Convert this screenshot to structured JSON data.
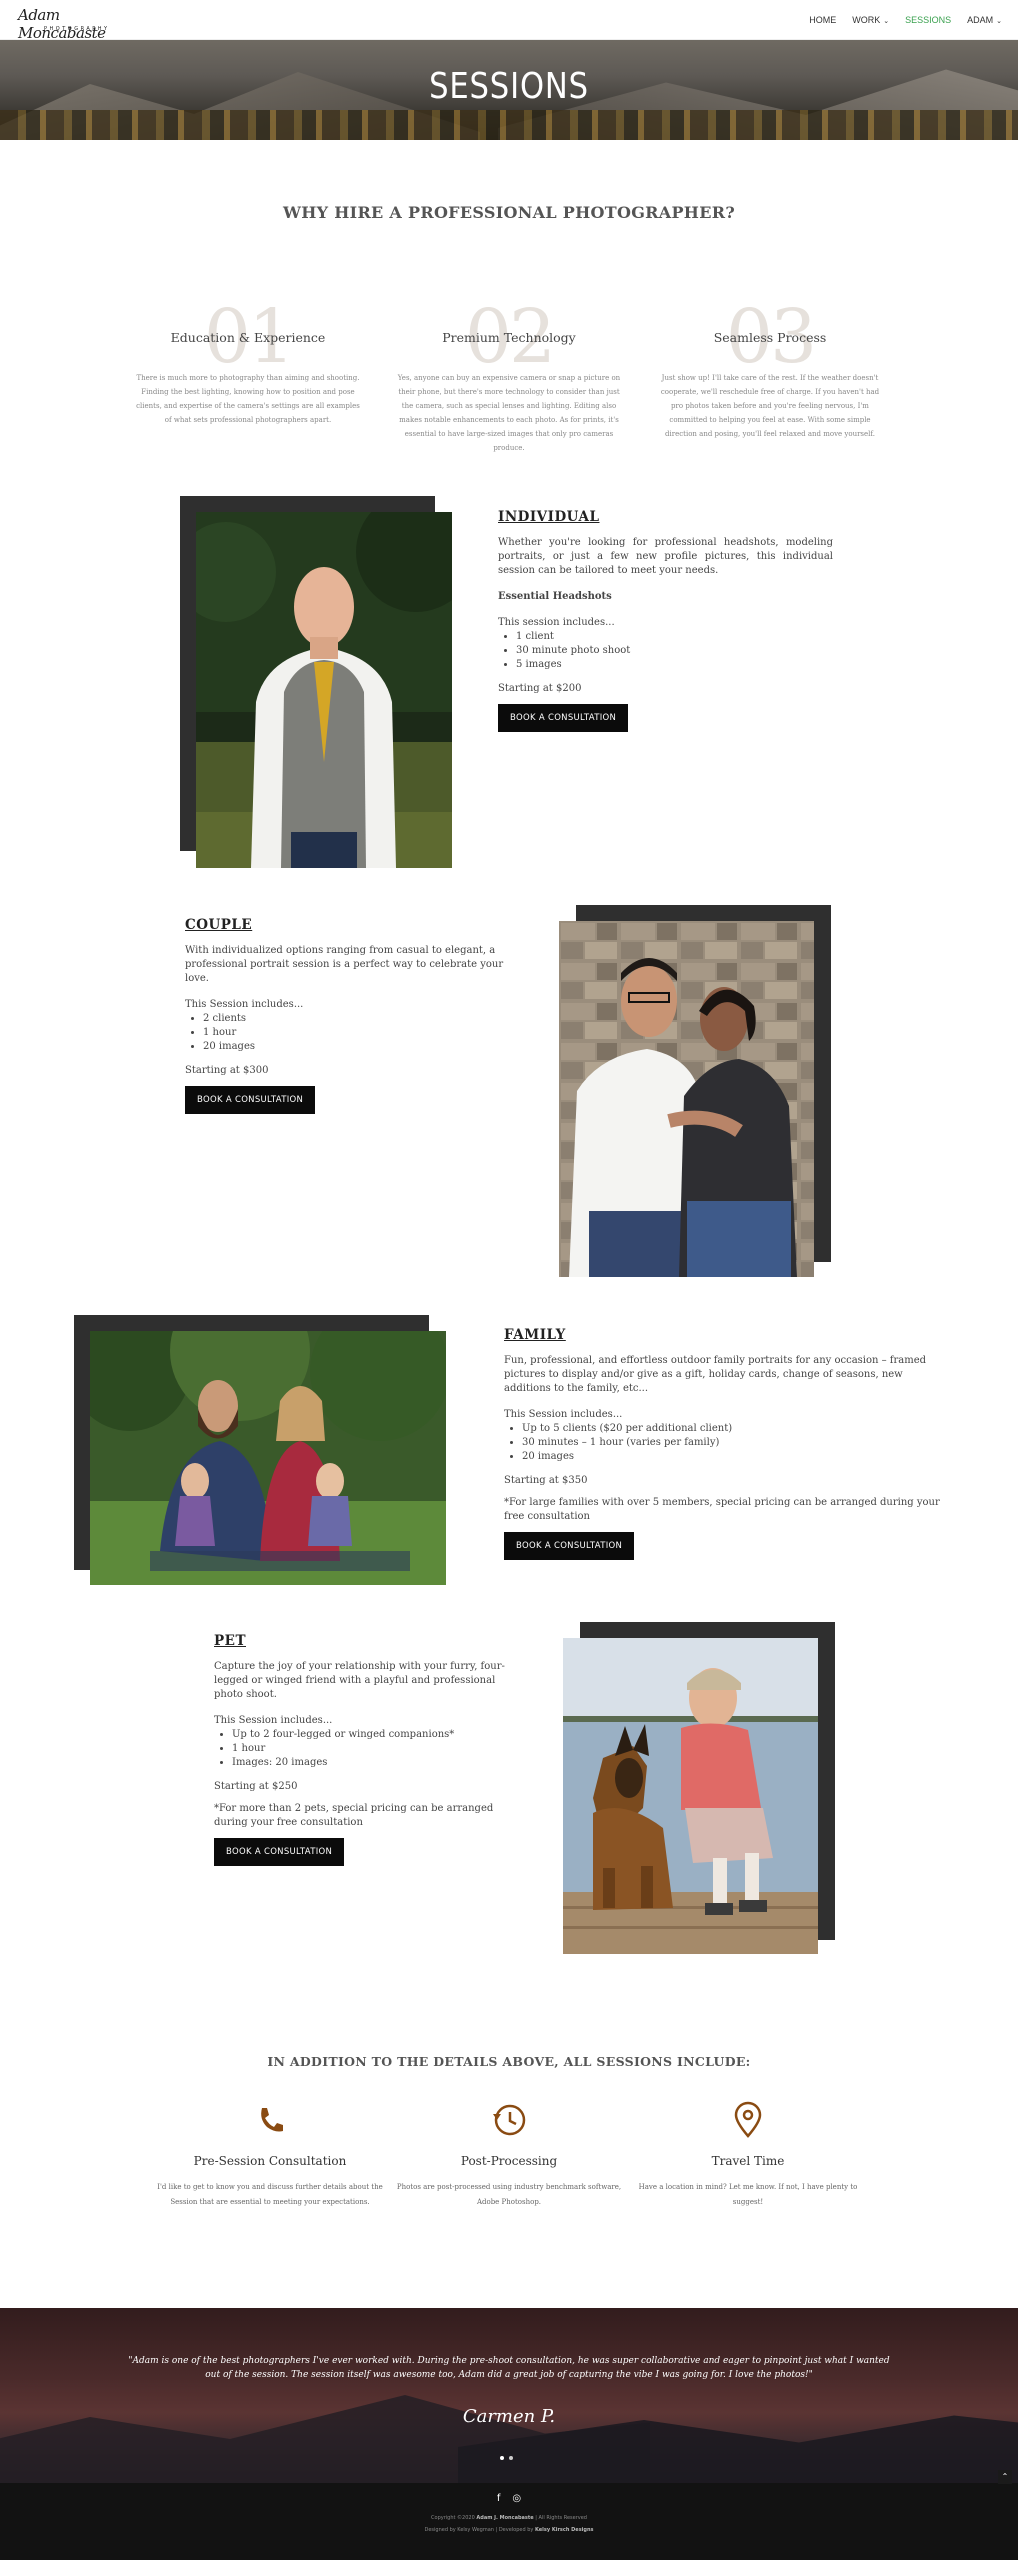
{
  "header": {
    "logo_script": "Adam Moncabaste",
    "logo_sub": "PHOTOGRAPHY",
    "nav": [
      {
        "label": "HOME"
      },
      {
        "label": "WORK"
      },
      {
        "label": "SESSIONS"
      },
      {
        "label": "ADAM"
      }
    ]
  },
  "hero": {
    "title": "SESSIONS"
  },
  "why": {
    "title": "WHY HIRE A PROFESSIONAL PHOTOGRAPHER?",
    "features": [
      {
        "num": "01",
        "title": "Education & Experience",
        "text": "There is much more to photography than aiming and shooting. Finding the best lighting, knowing how to position and pose clients, and expertise of the camera's settings are all examples of what sets professional photographers apart."
      },
      {
        "num": "02",
        "title": "Premium Technology",
        "text": "Yes, anyone can buy an expensive camera or snap a picture on their phone, but there's more technology to consider than just the camera, such as special lenses and lighting. Editing also makes notable enhancements to each photo. As for prints, it's essential to have large-sized images that only pro cameras produce."
      },
      {
        "num": "03",
        "title": "Seamless Process",
        "text": "Just show up! I'll take care of the rest. If the weather doesn't cooperate, we'll reschedule free of charge. If you haven't had pro photos taken before and you're feeling nervous, I'm committed to helping you feel at ease. With some simple direction and posing, you'll feel relaxed and move yourself."
      }
    ]
  },
  "sessions": {
    "individual": {
      "title": "INDIVIDUAL",
      "lead": "Whether you're looking for professional headshots, modeling portraits, or just a few new profile pictures, this individual session can be tailored to meet your needs.",
      "sub": "Essential Headshots",
      "includes": "This session includes...",
      "items": [
        "1 client",
        "30 minute photo shoot",
        "5 images"
      ],
      "price": "Starting at $200",
      "button": "BOOK A CONSULTATION"
    },
    "couple": {
      "title": "COUPLE",
      "lead": "With individualized options ranging from casual to elegant, a professional portrait session is a perfect way to celebrate your love.",
      "includes": "This Session includes...",
      "items": [
        "2 clients",
        "1 hour",
        "20 images"
      ],
      "price": "Starting at $300",
      "button": "BOOK A CONSULTATION"
    },
    "family": {
      "title": "FAMILY",
      "lead": "Fun, professional, and effortless outdoor family portraits for any occasion – framed pictures to display and/or give as a gift, holiday cards, change of seasons, new additions to the family, etc...",
      "includes": "This Session includes...",
      "items": [
        "Up to 5 clients ($20 per additional client)",
        "30 minutes – 1 hour (varies per family)",
        "20 images"
      ],
      "price": "Starting at $350",
      "note": "*For large families with over 5 members, special pricing can be arranged during your free consultation",
      "button": "BOOK A CONSULTATION"
    },
    "pet": {
      "title": "PET",
      "lead": "Capture the joy of your relationship with your furry, four-legged or winged friend with a playful and professional photo shoot.",
      "includes": "This Session includes...",
      "items": [
        "Up to 2 four-legged or winged companions*",
        "1 hour",
        "Images: 20 images"
      ],
      "price": "Starting at $250",
      "note": "*For more than 2 pets, special pricing can be arranged during your free consultation",
      "button": "BOOK A CONSULTATION"
    }
  },
  "includes": {
    "title": "IN ADDITION TO THE DETAILS ABOVE, ALL SESSIONS INCLUDE:",
    "accent": "#8a4b12",
    "items": [
      {
        "icon": "phone-icon",
        "title": "Pre-Session Consultation",
        "text": "I'd like to get to know you and discuss further details about the Session that are essential to meeting your expectations."
      },
      {
        "icon": "history-icon",
        "title": "Post-Processing",
        "text": "Photos are post-processed using industry benchmark software, Adobe Photoshop."
      },
      {
        "icon": "map-pin-icon",
        "title": "Travel Time",
        "text": "Have a location in mind? Let me know. If not, I have plenty to suggest!"
      }
    ]
  },
  "testimonial": {
    "quote": "\"Adam is one of the best photographers I've ever worked with. During the pre-shoot consultation, he was super collaborative and eager to pinpoint just what I wanted out of the session. The session itself was awesome too, Adam did a great job of capturing the vibe I was going for. I love the photos!\"",
    "author": "Carmen P."
  },
  "footer": {
    "social": [
      "f",
      "◎"
    ],
    "copy_pre": "Copyright ©2020",
    "copy_name": "Adam J. Moncabaste",
    "copy_post": "| All Rights Reserved",
    "credit_pre": "Designed by Kelsy Wegman | Developed by",
    "credit_name": "Kelsy Kirsch Designs"
  }
}
